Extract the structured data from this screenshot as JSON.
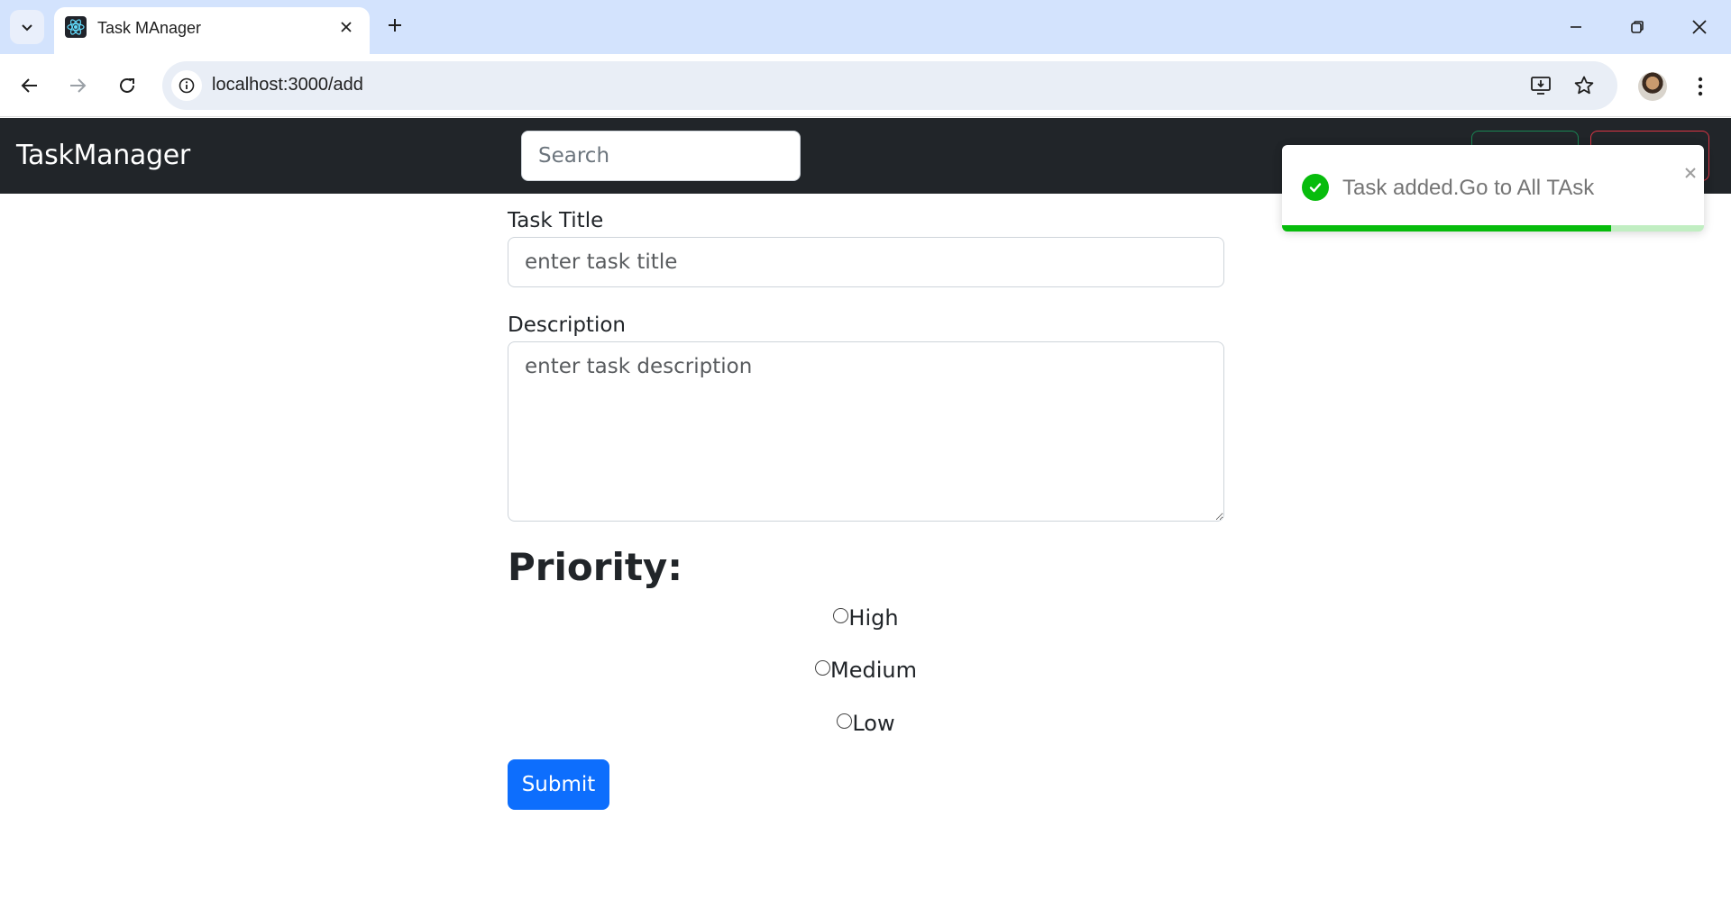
{
  "browser": {
    "tab_title": "Task MAnager",
    "url": "localhost:3000/add"
  },
  "navbar": {
    "brand": "TaskManager",
    "search_placeholder": "Search"
  },
  "toast": {
    "message": "Task added.Go to All TAsk",
    "type": "success",
    "progress": 0.78,
    "color": "#07bc0c"
  },
  "form": {
    "title_label": "Task Title",
    "title_placeholder": "enter task title",
    "description_label": "Description",
    "description_placeholder": "enter task description",
    "priority_heading": "Priority:",
    "priority_options": [
      "High",
      "Medium",
      "Low"
    ],
    "submit_label": "Submit"
  },
  "colors": {
    "navbar_bg": "#212529",
    "primary": "#0d6efd",
    "tabstrip_bg": "#d3e3fd"
  }
}
